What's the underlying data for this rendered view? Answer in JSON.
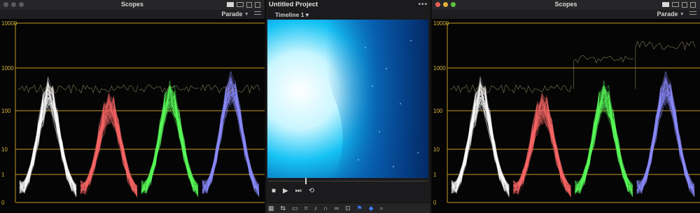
{
  "left_scope": {
    "title": "Scopes",
    "mode": "Parade",
    "axis_labels": [
      "10000",
      "1000",
      "100",
      "10",
      "1",
      "0"
    ]
  },
  "center": {
    "project_title": "Untitled Project",
    "timeline_name": "Timeline 1",
    "more_glyph": "•••",
    "transport": {
      "stop": "■",
      "play": "▶",
      "next": "⏭",
      "loop": "⟲"
    }
  },
  "right_scope": {
    "title": "Scopes",
    "mode": "Parade",
    "axis_labels": [
      "10000",
      "1000",
      "100",
      "10",
      "1",
      "0"
    ]
  },
  "colors": {
    "grid": "#c49a22",
    "label": "#d6b43c",
    "red_trace": "#ff6a6a",
    "green_trace": "#5cff5c",
    "blue_trace": "#8b8bff",
    "white_trace": "#ffffff"
  },
  "icons": [
    "stop-icon",
    "play-icon",
    "next-clip-icon",
    "loop-icon",
    "viewer-icon",
    "swap-icon",
    "display-icon",
    "crop-icon",
    "audio-icon",
    "magnet-icon",
    "link-icon",
    "lock-icon",
    "flag-icon",
    "marker-icon",
    "zoom-icon"
  ]
}
